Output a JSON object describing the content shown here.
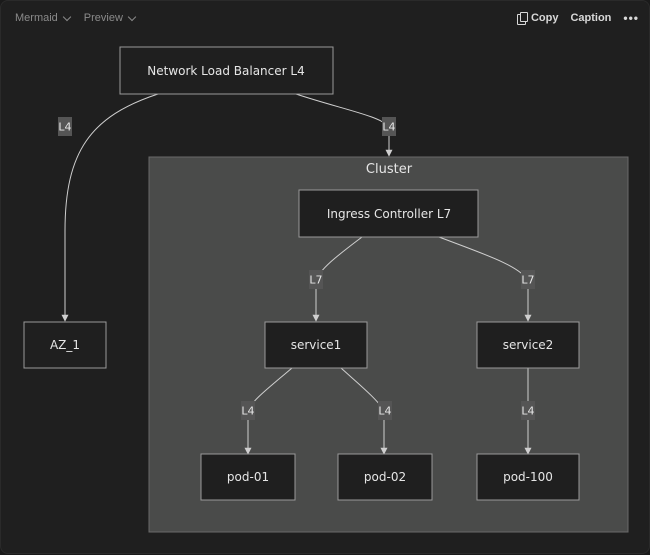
{
  "toolbar": {
    "language_label": "Mermaid",
    "view_label": "Preview",
    "copy_label": "Copy",
    "caption_label": "Caption",
    "more_label": "•••"
  },
  "diagram": {
    "cluster": {
      "id": "cluster",
      "label": "Cluster"
    },
    "nodes": [
      {
        "id": "nlb",
        "label": "Network Load Balancer L4"
      },
      {
        "id": "az1",
        "label": "AZ_1"
      },
      {
        "id": "ingress",
        "label": "Ingress Controller L7"
      },
      {
        "id": "service1",
        "label": "service1"
      },
      {
        "id": "service2",
        "label": "service2"
      },
      {
        "id": "pod01",
        "label": "pod-01"
      },
      {
        "id": "pod02",
        "label": "pod-02"
      },
      {
        "id": "pod100",
        "label": "pod-100"
      }
    ],
    "edges": [
      {
        "from": "nlb",
        "to": "az1",
        "label": "L4"
      },
      {
        "from": "nlb",
        "to": "cluster",
        "label": "L4"
      },
      {
        "from": "ingress",
        "to": "service1",
        "label": "L7"
      },
      {
        "from": "ingress",
        "to": "service2",
        "label": "L7"
      },
      {
        "from": "service1",
        "to": "pod01",
        "label": "L4"
      },
      {
        "from": "service1",
        "to": "pod02",
        "label": "L4"
      },
      {
        "from": "service2",
        "to": "pod100",
        "label": "L4"
      }
    ]
  }
}
